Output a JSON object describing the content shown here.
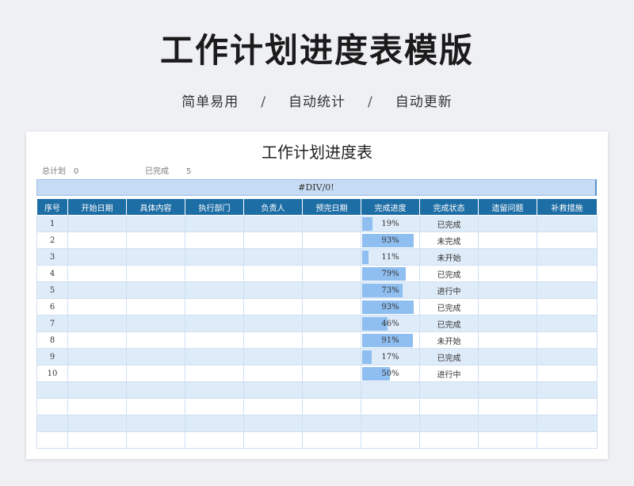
{
  "header": {
    "title": "工作计划进度表模版",
    "tags": [
      "简单易用",
      "自动统计",
      "自动更新"
    ],
    "separator": "/"
  },
  "sheet": {
    "title": "工作计划进度表",
    "summary": {
      "total_label": "总计划",
      "total_value": "0",
      "done_label": "已完成",
      "done_value": "5"
    },
    "banner": "#DIV/0!",
    "columns": [
      "序号",
      "开始日期",
      "具体内容",
      "执行部门",
      "负责人",
      "预完日期",
      "完成进度",
      "完成状态",
      "遗留问题",
      "补救措施"
    ],
    "rows": [
      {
        "no": "1",
        "progress": "19%",
        "progress_value": 0.19,
        "status": "已完成"
      },
      {
        "no": "2",
        "progress": "93%",
        "progress_value": 0.93,
        "status": "未完成"
      },
      {
        "no": "3",
        "progress": "11%",
        "progress_value": 0.11,
        "status": "未开始"
      },
      {
        "no": "4",
        "progress": "79%",
        "progress_value": 0.79,
        "status": "已完成"
      },
      {
        "no": "5",
        "progress": "73%",
        "progress_value": 0.73,
        "status": "进行中"
      },
      {
        "no": "6",
        "progress": "93%",
        "progress_value": 0.93,
        "status": "已完成"
      },
      {
        "no": "7",
        "progress": "46%",
        "progress_value": 0.46,
        "status": "已完成"
      },
      {
        "no": "8",
        "progress": "91%",
        "progress_value": 0.91,
        "status": "未开始"
      },
      {
        "no": "9",
        "progress": "17%",
        "progress_value": 0.17,
        "status": "已完成"
      },
      {
        "no": "10",
        "progress": "50%",
        "progress_value": 0.5,
        "status": "进行中"
      }
    ],
    "empty_rows": 4,
    "colors": {
      "header_bg": "#1e6ea6",
      "stripe_bg": "#deebf8",
      "banner_bg": "#c6dbf4",
      "progress_bar": "#8fbef0"
    }
  }
}
